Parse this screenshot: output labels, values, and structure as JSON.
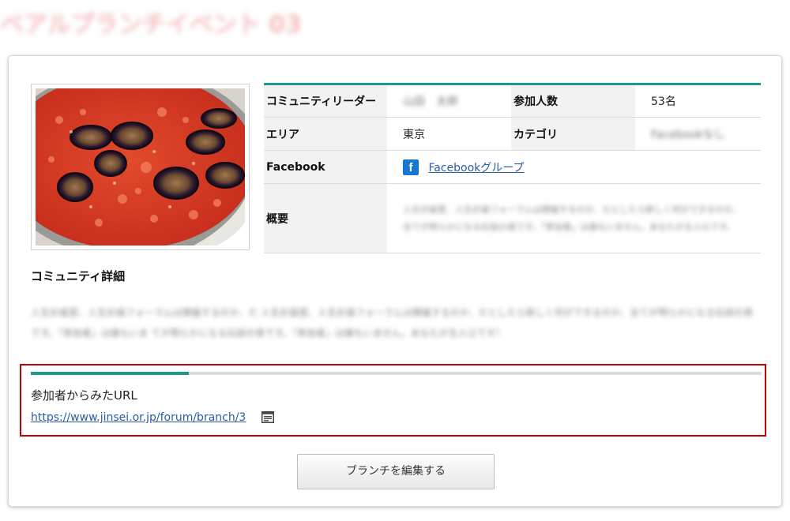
{
  "page": {
    "heading": "ベアルプランチイベント 03"
  },
  "community": {
    "photo_alt": "tomato-eggplant-sauce-photo",
    "table": {
      "leader_label": "コミュニティリーダー",
      "leader_value": "山田　太郎",
      "participants_label": "参加人数",
      "participants_value": "53名",
      "area_label": "エリア",
      "area_value": "東京",
      "category_label": "カテゴリ",
      "category_value": "Facebookなし",
      "facebook_label": "Facebook",
      "facebook_icon": "facebook-icon",
      "facebook_link": "Facebookグループ",
      "summary_label": "概要",
      "summary_value": "人生計画室、人生計画フォーラムは開催するのか、だとしたら新しく何ができるのか、全てが明らかになる伝説の夜です。「参加者」は誰もいません。あなたが主人公です。"
    },
    "detail_title": "コミュニティ詳細",
    "detail_text": "人生計画室、人生計画フォーラムは開催するのか、だ 人生計画室、人生計画フォーラムは開催するのか、だとしたら新しく何ができるのか、全てが明らかになる伝説の夜です。「参加者」は誰もいま てが明らかになる伝説の夜です。「参加者」は誰もいません。あなたが主人公です！"
  },
  "url_section": {
    "progress": 0.216,
    "label": "参加者からみたURL",
    "url": "https://www.jinsei.or.jp/forum/branch/3",
    "copy_icon": "copy-icon"
  },
  "actions": {
    "edit_label": "ブランチを編集する"
  },
  "colors": {
    "accent": "#1a9b8a",
    "highlight_border": "#c40000",
    "link": "#2a5da8",
    "facebook": "#1877d4"
  }
}
